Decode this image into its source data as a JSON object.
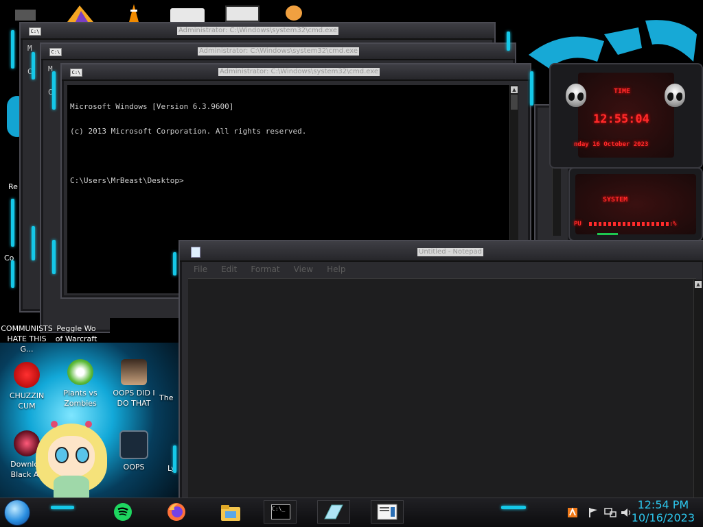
{
  "desktop": {
    "icons": [
      {
        "label_line1": "COMMUNISTS",
        "label_line2": "HATE THIS G..."
      },
      {
        "label_line1": "Peggle Wo",
        "label_line2": "of Warcraft"
      },
      {
        "label_line1": "CHUZZIN",
        "label_line2": "CUM"
      },
      {
        "label_line1": "Plants vs",
        "label_line2": "Zombies"
      },
      {
        "label_line1": "OOPS DID I",
        "label_line2": "DO THAT"
      },
      {
        "label_line1": "The",
        "label_line2": ""
      },
      {
        "label_line1": "Downloa",
        "label_line2": "Black All"
      },
      {
        "label_line1": "OOPS",
        "label_line2": ""
      },
      {
        "label_line1": "Ly",
        "label_line2": ""
      }
    ],
    "partial_labels": [
      "Re",
      "Co"
    ]
  },
  "cmd_windows": [
    {
      "title": "Administrator: C:\\Windows\\system32\\cmd.exe"
    },
    {
      "title": "Administrator: C:\\Windows\\system32\\cmd.exe"
    },
    {
      "title": "Administrator: C:\\Windows\\system32\\cmd.exe"
    }
  ],
  "cmd_bg_letters": [
    "M",
    "C",
    "M",
    "C"
  ],
  "console": {
    "line1": "Microsoft Windows [Version 6.3.9600]",
    "line2": "(c) 2013 Microsoft Corporation. All rights reserved.",
    "line3": "",
    "line4": "C:\\Users\\MrBeast\\Desktop>"
  },
  "notepad": {
    "title": "Untitled - Notepad",
    "menu": [
      "File",
      "Edit",
      "Format",
      "View",
      "Help"
    ]
  },
  "gadget": {
    "time_label": "TIME",
    "time": "12:55:04",
    "date": "nday 16 October 2023",
    "system_label": "SYSTEM",
    "cpu_label": "PU",
    "percent": "%"
  },
  "taskbar": {
    "icons": [
      "spotify-icon",
      "firefox-icon",
      "file-explorer-icon"
    ],
    "cmd_button_label": "C:\\_",
    "clock_time": "12:54 PM",
    "clock_date": "10/16/2023"
  },
  "colors": {
    "accent_cyan": "#15c8e8",
    "gadget_red": "#ff2b2b",
    "clock_blue": "#2dc9f0"
  }
}
